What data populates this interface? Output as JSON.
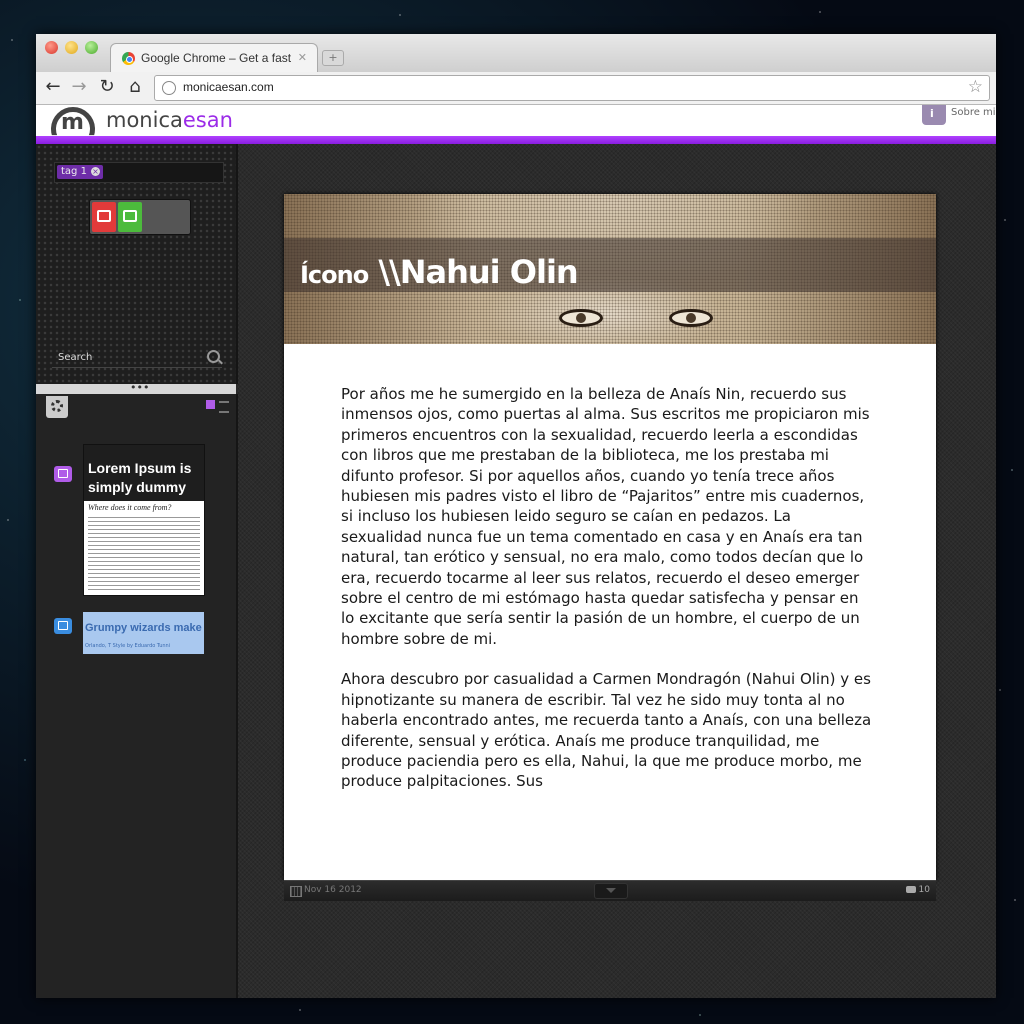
{
  "browser": {
    "tab_title": "Google Chrome – Get a fast",
    "tab_close": "✕",
    "new_tab": "+",
    "url": "monicaesan.com",
    "back": "←",
    "forward": "→",
    "reload": "↻",
    "home": "⌂",
    "star": "☆"
  },
  "site": {
    "logo_prefix": "monica",
    "logo_accent": "esan",
    "about_label": "Sobre mi",
    "accent_color": "#9b2be8"
  },
  "sidebar": {
    "tag": "tag 1",
    "tag_remove": "×",
    "search_label": "Search",
    "divider_dots": "•••",
    "posts": [
      {
        "icon": "book-icon",
        "title": "Lorem Ipsum is simply dummy",
        "subtitle": "Where does it come from?"
      },
      {
        "icon": "twitter-icon",
        "title": "Grumpy wizards make to",
        "meta": "Orlando, T Style by Eduardo Tunni"
      }
    ]
  },
  "article": {
    "title_prefix": "Ícono",
    "title_main": "\\\\Nahui Olin",
    "paragraphs": [
      "Por años me he sumergido en la belleza de Anaís Nin, recuerdo sus inmensos ojos, como puertas al alma. Sus escritos me propiciaron mis primeros encuentros con la sexualidad, recuerdo leerla a escondidas con libros que me prestaban de la biblioteca, me los prestaba mi difunto profesor. Si por aquellos años, cuando yo tenía trece años hubiesen mis padres visto el libro de “Pajaritos” entre mis cuadernos, si incluso los hubiesen leido seguro se caían en pedazos. La sexualidad nunca fue un tema comentado en casa y en Anaís era tan natural, tan erótico y sensual, no era malo, como todos decían que lo era, recuerdo tocarme al leer sus relatos, recuerdo el deseo emerger sobre el centro de mi estómago hasta quedar satisfecha y pensar en lo excitante que sería sentir la pasión de un hombre, el cuerpo de un hombre sobre de mi.",
      "Ahora descubro por casualidad a Carmen Mondragón (Nahui Olin) y es hipnotizante su manera de escribir. Tal vez he sido muy tonta al no haberla encontrado antes, me recuerda tanto a Anaís, con una belleza diferente, sensual y erótica. Anaís me produce tranquilidad, me produce paciendia pero es ella, Nahui, la que me produce morbo, me produce palpitaciones. Sus"
    ],
    "date": "Nov 16 2012",
    "comments": "10"
  }
}
